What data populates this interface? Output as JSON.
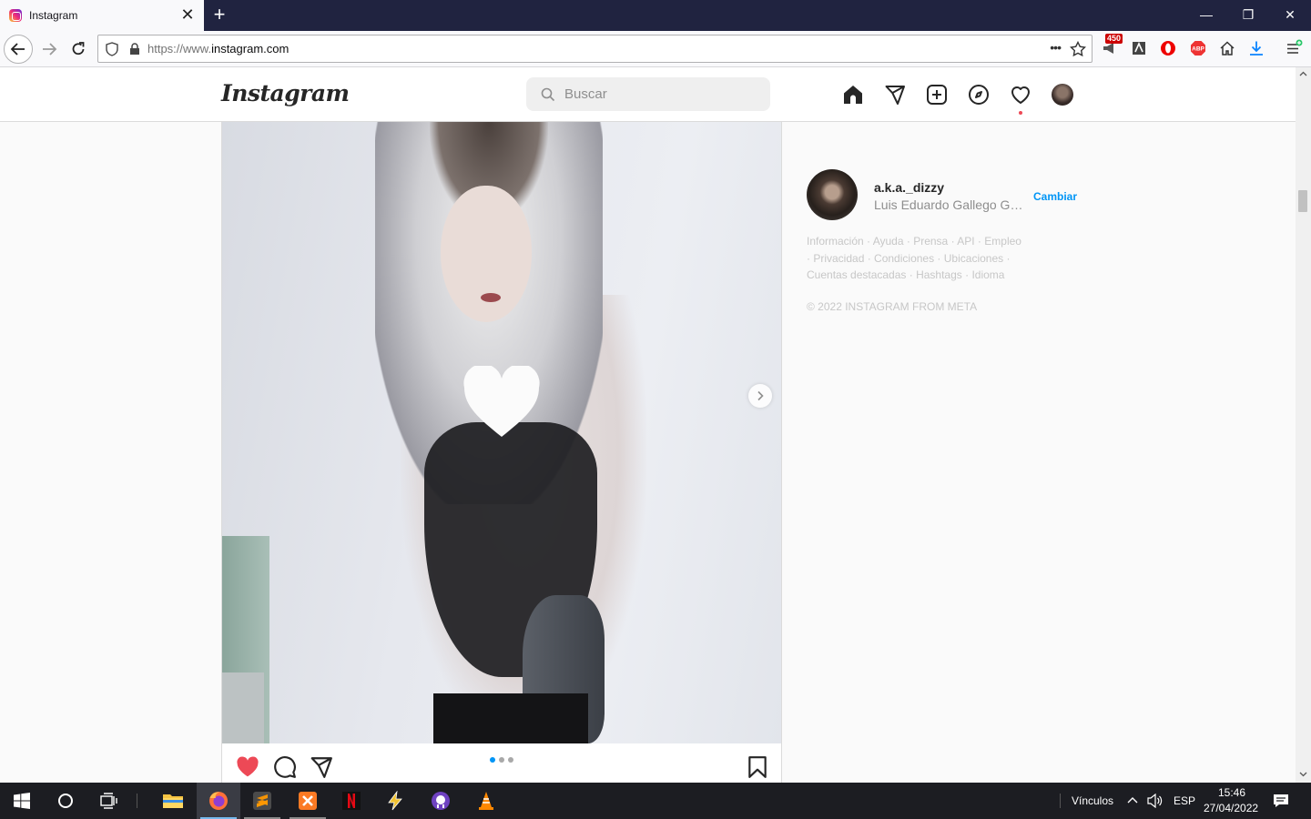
{
  "browser": {
    "tab_title": "Instagram",
    "tab_close": "✕",
    "new_tab": "+",
    "url_prefix": "https://www.",
    "url_host": "instagram.com",
    "page_actions": "•••",
    "extension_badge": "450",
    "window_controls": {
      "minimize": "—",
      "restore": "❐",
      "close": "✕"
    }
  },
  "instagram": {
    "logo": "Instagram",
    "search_placeholder": "Buscar",
    "nav_icons": [
      "home-icon",
      "direct-icon",
      "new-post-icon",
      "explore-icon",
      "activity-icon",
      "profile-avatar"
    ]
  },
  "post": {
    "carousel_total": 3,
    "carousel_index": 1,
    "liked": true,
    "like_color": "#ed4956"
  },
  "sidebar": {
    "username": "a.k.a._dizzy",
    "full_name": "Luis Eduardo Gallego Gar...",
    "switch_label": "Cambiar",
    "footer_links": [
      "Información",
      "Ayuda",
      "Prensa",
      "API",
      "Empleo",
      "Privacidad",
      "Condiciones",
      "Ubicaciones",
      "Cuentas destacadas",
      "Hashtags",
      "Idioma"
    ],
    "copyright": "© 2022 INSTAGRAM FROM META"
  },
  "taskbar": {
    "apps": [
      "windows-start",
      "search",
      "task-view",
      "file-explorer",
      "firefox",
      "sublime-text",
      "xampp",
      "netflix",
      "app-bolt",
      "github-desktop",
      "vlc"
    ],
    "links_label": "Vínculos",
    "language": "ESP",
    "time": "15:46",
    "date": "27/04/2022"
  },
  "colors": {
    "accent": "#0095f6",
    "like": "#ed4956",
    "tabbar": "#202340",
    "taskbar": "#1c1d22"
  }
}
